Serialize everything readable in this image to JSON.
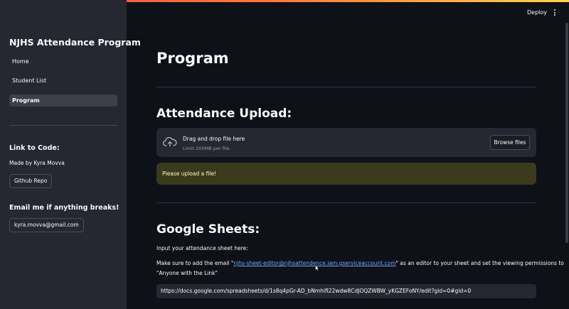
{
  "app": {
    "title": "NJHS Attendance Program"
  },
  "colors": {
    "accent": "#ff4b4b",
    "link": "#6fa8ff",
    "warning_bg": "#3b3a1d",
    "sidebar_bg": "#262730",
    "main_bg": "#0e1117"
  },
  "sidebar": {
    "nav": [
      {
        "label": "Home"
      },
      {
        "label": "Student List"
      },
      {
        "label": "Program",
        "active": true
      }
    ],
    "code_heading": "Link to Code:",
    "made_by": "Made by Kyra Movva",
    "github_button": "Github Repo",
    "email_heading": "Email me if anything breaks!",
    "email_button": "kyra.movva@gmail.com"
  },
  "header": {
    "deploy_label": "Deploy",
    "menu_icon": "kebab-menu-icon"
  },
  "main": {
    "title": "Program",
    "upload_heading": "Attendance Upload:",
    "uploader": {
      "icon": "cloud-upload-icon",
      "title": "Drag and drop file here",
      "limit": "Limit 200MB per file",
      "browse_label": "Browse files"
    },
    "warning": "Please upload a file!",
    "sheets_heading": "Google Sheets:",
    "sheet_prompt": "Input your attendance sheet here:",
    "instructions": {
      "before": "Make sure to add the email \"",
      "email": "njhs-sheet-editor@njhsattendence.iam.gserviceaccount.com",
      "after": "\" as an editor to your sheet and set the viewing permissions to",
      "line2": "\"Anyone with the Link\""
    },
    "sheet_url": "https://docs.google.com/spreadsheets/d/1s8q4pGr-AD_bNmhifI22wdw8CdJOQZWBW_yKGZEFoNY/edit?gid=0#gid=0"
  }
}
